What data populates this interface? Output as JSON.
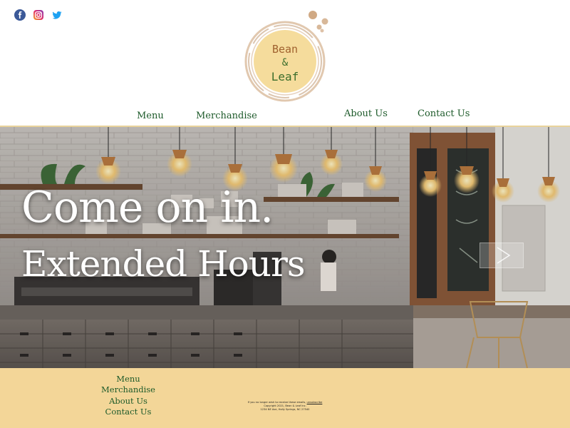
{
  "social": {
    "icons": [
      "facebook-icon",
      "instagram-icon",
      "twitter-icon"
    ],
    "colors": {
      "facebook": "#3b5998",
      "instagram": "#e1306c",
      "twitter": "#1da1f2"
    }
  },
  "logo": {
    "line1": "Bean",
    "line2": "&",
    "line3": "Leaf"
  },
  "nav": {
    "menu": "Menu",
    "merchandise": "Merchandise",
    "about": "About Us",
    "contact": "Contact Us"
  },
  "hero": {
    "line1": "Come on in.",
    "line2": "Extended Hours",
    "next_symbol": "next-arrow-icon"
  },
  "footer": {
    "links": [
      "Menu",
      "Merchandise",
      "About Us",
      "Contact Us"
    ],
    "note_pre": "If you no longer wish to receive these emails,",
    "note_link": "unsubscribe",
    "copyright": "Copyright 2021, Bean & Leaf Inc.",
    "address": "1234 NE Ave, Holly Springs, NC 27540"
  },
  "colors": {
    "nav_text": "#1d5a2a",
    "footer_bg": "#f3d698",
    "logo_fill": "#f5dc9c",
    "logo_ring": "#c89a6e",
    "logo_text_brown": "#a0622f",
    "logo_text_green": "#3c6e2c"
  }
}
